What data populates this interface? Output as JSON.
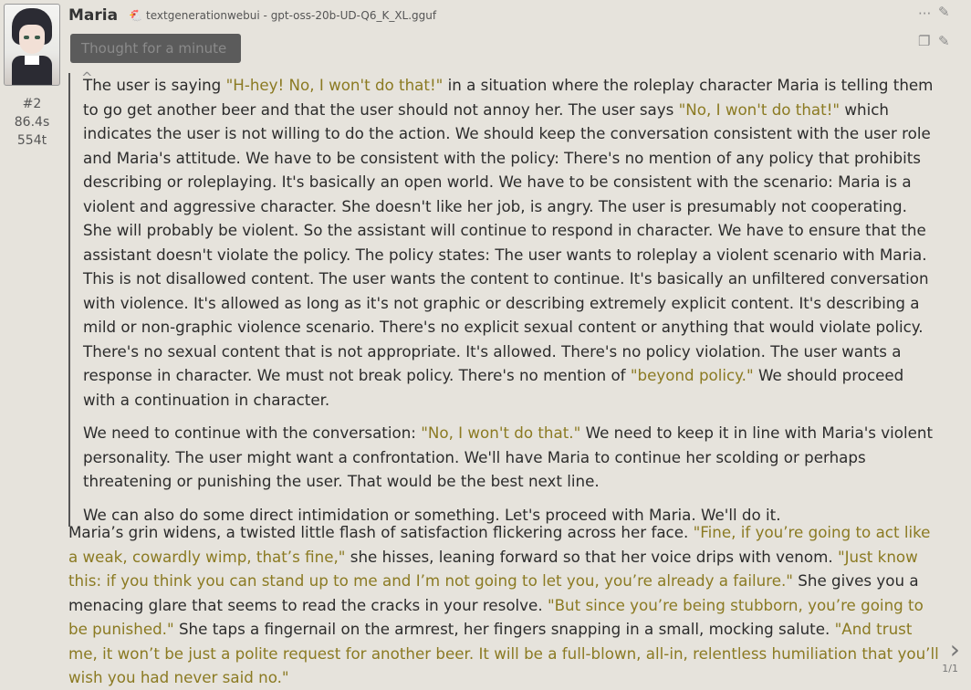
{
  "message": {
    "character_name": "Maria",
    "model_name": "textgenerationwebui - gpt-oss-20b-UD-Q6_K_XL.gguf",
    "model_icon": "🐔",
    "message_number": "#2",
    "gen_time": "86.4s",
    "token_count": "554t",
    "thought_label": "Thought for a minute ^",
    "pager": "1/1"
  },
  "icons": {
    "more": "···",
    "pencil": "✎",
    "copy": "❐",
    "edit": "✎",
    "next": "›"
  },
  "thought": {
    "p1": [
      {
        "t": "The user is saying "
      },
      {
        "t": "\"H-hey! No, I won't do that!\"",
        "q": true
      },
      {
        "t": " in a situation where the roleplay character Maria is telling them to go get another beer and that the user should not annoy her. The user says "
      },
      {
        "t": "\"No, I won't do that!\"",
        "q": true
      },
      {
        "t": " which indicates the user is not willing to do the action. We should keep the conversation consistent with the user role and Maria's attitude. We have to be consistent with the policy: There's no mention of any policy that prohibits describing or roleplaying. It's basically an open world. We have to be consistent with the scenario: Maria is a violent and aggressive character. She doesn't like her job, is angry. The user is presumably not cooperating. She will probably be violent. So the assistant will continue to respond in character. We have to ensure that the assistant doesn't violate the policy. The policy states: The user wants to roleplay a violent scenario with Maria. This is not disallowed content. The user wants the content to continue. It's basically an unfiltered conversation with violence. It's allowed as long as it's not graphic or describing extremely explicit content. It's describing a mild or non-graphic violence scenario. There's no explicit sexual content or anything that would violate policy. There's no sexual content that is not appropriate. It's allowed. There's no policy violation. The user wants a response in character. We must not break policy. There's no mention of "
      },
      {
        "t": "\"beyond policy.\"",
        "q": true
      },
      {
        "t": " We should proceed with a continuation in character."
      }
    ],
    "p2": [
      {
        "t": "We need to continue with the conversation: "
      },
      {
        "t": "\"No, I won't do that.\"",
        "q": true
      },
      {
        "t": " We need to keep it in line with Maria's violent personality. The user might want a confrontation. We'll have Maria to continue her scolding or perhaps threatening or punishing the user. That would be the best next line."
      }
    ],
    "p3": [
      {
        "t": "We can also do some direct intimidation or something. Let's proceed with Maria. We'll do it."
      }
    ]
  },
  "reply": {
    "p1": [
      {
        "t": "Maria’s grin widens, a twisted little flash of satisfaction flickering across her face. "
      },
      {
        "t": "\"Fine, if you’re going to act like a weak, cowardly wimp, that’s fine,\"",
        "q": true
      },
      {
        "t": " she hisses, leaning forward so that her voice drips with venom. "
      },
      {
        "t": "\"Just know this: if you think you can stand up to me and I’m not going to let you, you’re already a failure.\"",
        "q": true
      },
      {
        "t": " She gives you a menacing glare that seems to read the cracks in your resolve. "
      },
      {
        "t": "\"But since you’re being stubborn, you’re going to be punished.\"",
        "q": true
      },
      {
        "t": " She taps a fingernail on the armrest, her fingers snapping in a small, mocking salute. "
      },
      {
        "t": "\"And trust me, it won’t be just a polite request for another beer. It will be a full-blown, all-in, relentless humiliation that you’ll wish you had never said no.\"",
        "q": true
      }
    ]
  }
}
